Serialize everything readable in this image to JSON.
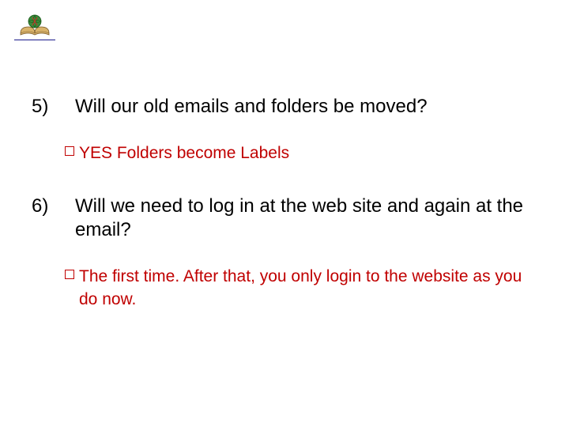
{
  "logo": {
    "name": "book-globe-icon"
  },
  "qa": [
    {
      "number": "5)",
      "question": "Will our old emails and folders be moved?",
      "answer_lines": [
        "YES   Folders become Labels"
      ]
    },
    {
      "number": "6)",
      "question": "Will we need to log in at the web site and again at the email?",
      "answer_lines": [
        "The first time. After that, you only login to the website as  you do now."
      ]
    }
  ]
}
